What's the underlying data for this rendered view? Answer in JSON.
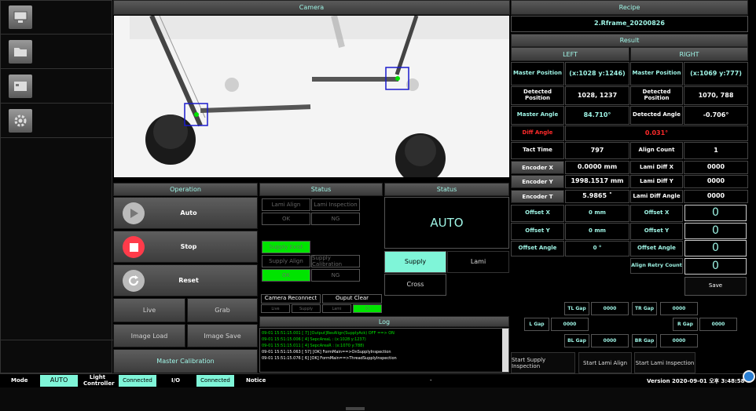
{
  "camera": {
    "title": "Camera"
  },
  "recipe": {
    "title": "Recipe",
    "name": "2.Rframe_20200826"
  },
  "result": {
    "title": "Result",
    "left": "LEFT",
    "right": "RIGHT",
    "master_position_label": "Master Position",
    "left_master_position": "(x:1028 y:1246)",
    "right_master_position": "(x:1069 y:777)",
    "detected_position_label": "Detected Position",
    "left_detected_position": "1028, 1237",
    "right_detected_position": "1070, 788",
    "master_angle_label": "Master Angle",
    "left_master_angle": "84.710°",
    "detected_angle_label": "Detected Angle",
    "right_detected_angle": "-0.706°",
    "diff_angle_label": "Diff Angle",
    "diff_angle": "0.031°",
    "tact_time_label": "Tact Time",
    "tact_time": "797",
    "align_count_label": "Align Count",
    "align_count": "1",
    "encoder_x_label": "Encoder X",
    "encoder_x": "0.0000 mm",
    "lami_diff_x_label": "Lami Diff X",
    "lami_diff_x": "0000",
    "encoder_y_label": "Encoder Y",
    "encoder_y": "1998.1517 mm",
    "lami_diff_y_label": "Lami Diff Y",
    "lami_diff_y": "0000",
    "encoder_t_label": "Encoder T",
    "encoder_t": "5.9865 ˚",
    "lami_diff_angle_label": "Lami Diff Angle",
    "lami_diff_angle": "0000",
    "offset_x_label": "Offset X",
    "offset_x": "0 mm",
    "offset_x_right_label": "Offset X",
    "offset_x_right": "0",
    "offset_y_label": "Offset Y",
    "offset_y": "0 mm",
    "offset_y_right_label": "Offset Y",
    "offset_y_right": "0",
    "offset_angle_label": "Offset Angle",
    "offset_angle": "0 °",
    "offset_angle_right_label": "Offset Angle",
    "offset_angle_right": "0",
    "align_retry_label": "Align Retry Count",
    "align_retry": "0",
    "save_label": "Save"
  },
  "gaps": {
    "tl_label": "TL Gap",
    "tl": "0000",
    "tr_label": "TR Gap",
    "tr": "0000",
    "l_label": "L Gap",
    "l": "0000",
    "r_label": "R Gap",
    "r": "0000",
    "bl_label": "BL Gap",
    "bl": "0000",
    "br_label": "BR Gap",
    "br": "0000"
  },
  "inspection": {
    "supply": "Start Supply Inspection",
    "lami": "Start Lami Align",
    "lami_insp": "Start Lami Inspection"
  },
  "operation": {
    "title": "Operation",
    "auto": "Auto",
    "stop": "Stop",
    "reset": "Reset",
    "live": "Live",
    "grab": "Grab",
    "image_load": "Image Load",
    "image_save": "Image Save",
    "master_calibration": "Master Calibration"
  },
  "status1": {
    "title": "Status",
    "lami_align": "Lami Align",
    "lami_inspection": "Lami Inspection",
    "ok": "OK",
    "ng": "NG",
    "supply_exist": "Supply Exist",
    "supply_align": "Supply Align",
    "supply_calibration": "Supply Calibration",
    "ok2": "OK",
    "ng2": "NG"
  },
  "status2": {
    "title": "Status",
    "mode": "AUTO",
    "supply": "Supply",
    "lami": "Lami",
    "cross": "Cross"
  },
  "reconnect": {
    "camera_reconnect": "Camera Reconnect",
    "output_clear": "Ouput Clear",
    "live": "Live",
    "supply": "Supply",
    "lami": "Lami",
    "io": "IO"
  },
  "log": {
    "title": "Log",
    "lines": [
      "09-01 15:51:15.001 [    7] [Output]ResAlign(SupplyAck) OFF ==> ON",
      "09-01 15:51:15.006 [    4] SepcAreaL : (x:1028 y:1237)",
      "09-01 15:51:15.011 [    4] SepcAreaR : (x:1070 y:788)",
      "09-01 15:51:15.063 [   57] [OK] FormMain==>OnSupplyInspection",
      "09-01 15:51:15.076 [    6] [OK] FormMain==>ThreadSupplyInspection"
    ]
  },
  "statusbar": {
    "mode_label": "Mode",
    "mode": "AUTO",
    "light_label": "Light Controller",
    "light": "Connected",
    "io_label": "I/O",
    "io": "Connected",
    "notice_label": "Notice",
    "notice": "-",
    "version": "Version 2020-09-01 오후 3:48:58"
  },
  "colors": {
    "accent": "#9ff5e6",
    "green": "#00e400",
    "red": "#ff2a2a",
    "selected": "#7ff5d8"
  }
}
